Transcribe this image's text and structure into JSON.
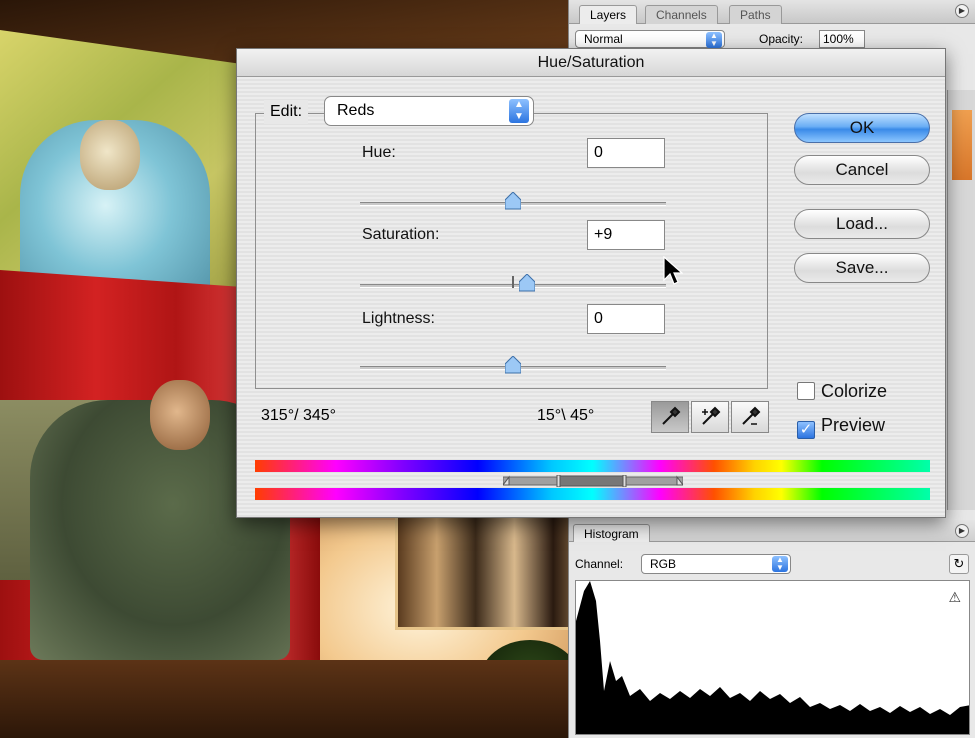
{
  "layers_palette": {
    "tabs": [
      "Layers",
      "Channels",
      "Paths"
    ],
    "blend_mode": "Normal",
    "opacity_label": "Opacity:",
    "opacity_value": "100%"
  },
  "dialog": {
    "title": "Hue/Saturation",
    "edit_label": "Edit:",
    "edit_value": "Reds",
    "hue": {
      "label": "Hue:",
      "value": "0",
      "slider_fraction": 0.5
    },
    "saturation": {
      "label": "Saturation:",
      "value": "+9",
      "slider_fraction": 0.545
    },
    "lightness": {
      "label": "Lightness:",
      "value": "0",
      "slider_fraction": 0.5
    },
    "buttons": {
      "ok": "OK",
      "cancel": "Cancel",
      "load": "Load...",
      "save": "Save..."
    },
    "colorize": {
      "label": "Colorize",
      "checked": false
    },
    "preview": {
      "label": "Preview",
      "checked": true
    },
    "range_left": "315°/ 345°",
    "range_right": "15°\\ 45°"
  },
  "histogram": {
    "tab": "Histogram",
    "channel_label": "Channel:",
    "channel_value": "RGB"
  },
  "colors": {
    "accent_blue": "#3a8ae8",
    "dialog_bg": "#e8e8e8"
  }
}
